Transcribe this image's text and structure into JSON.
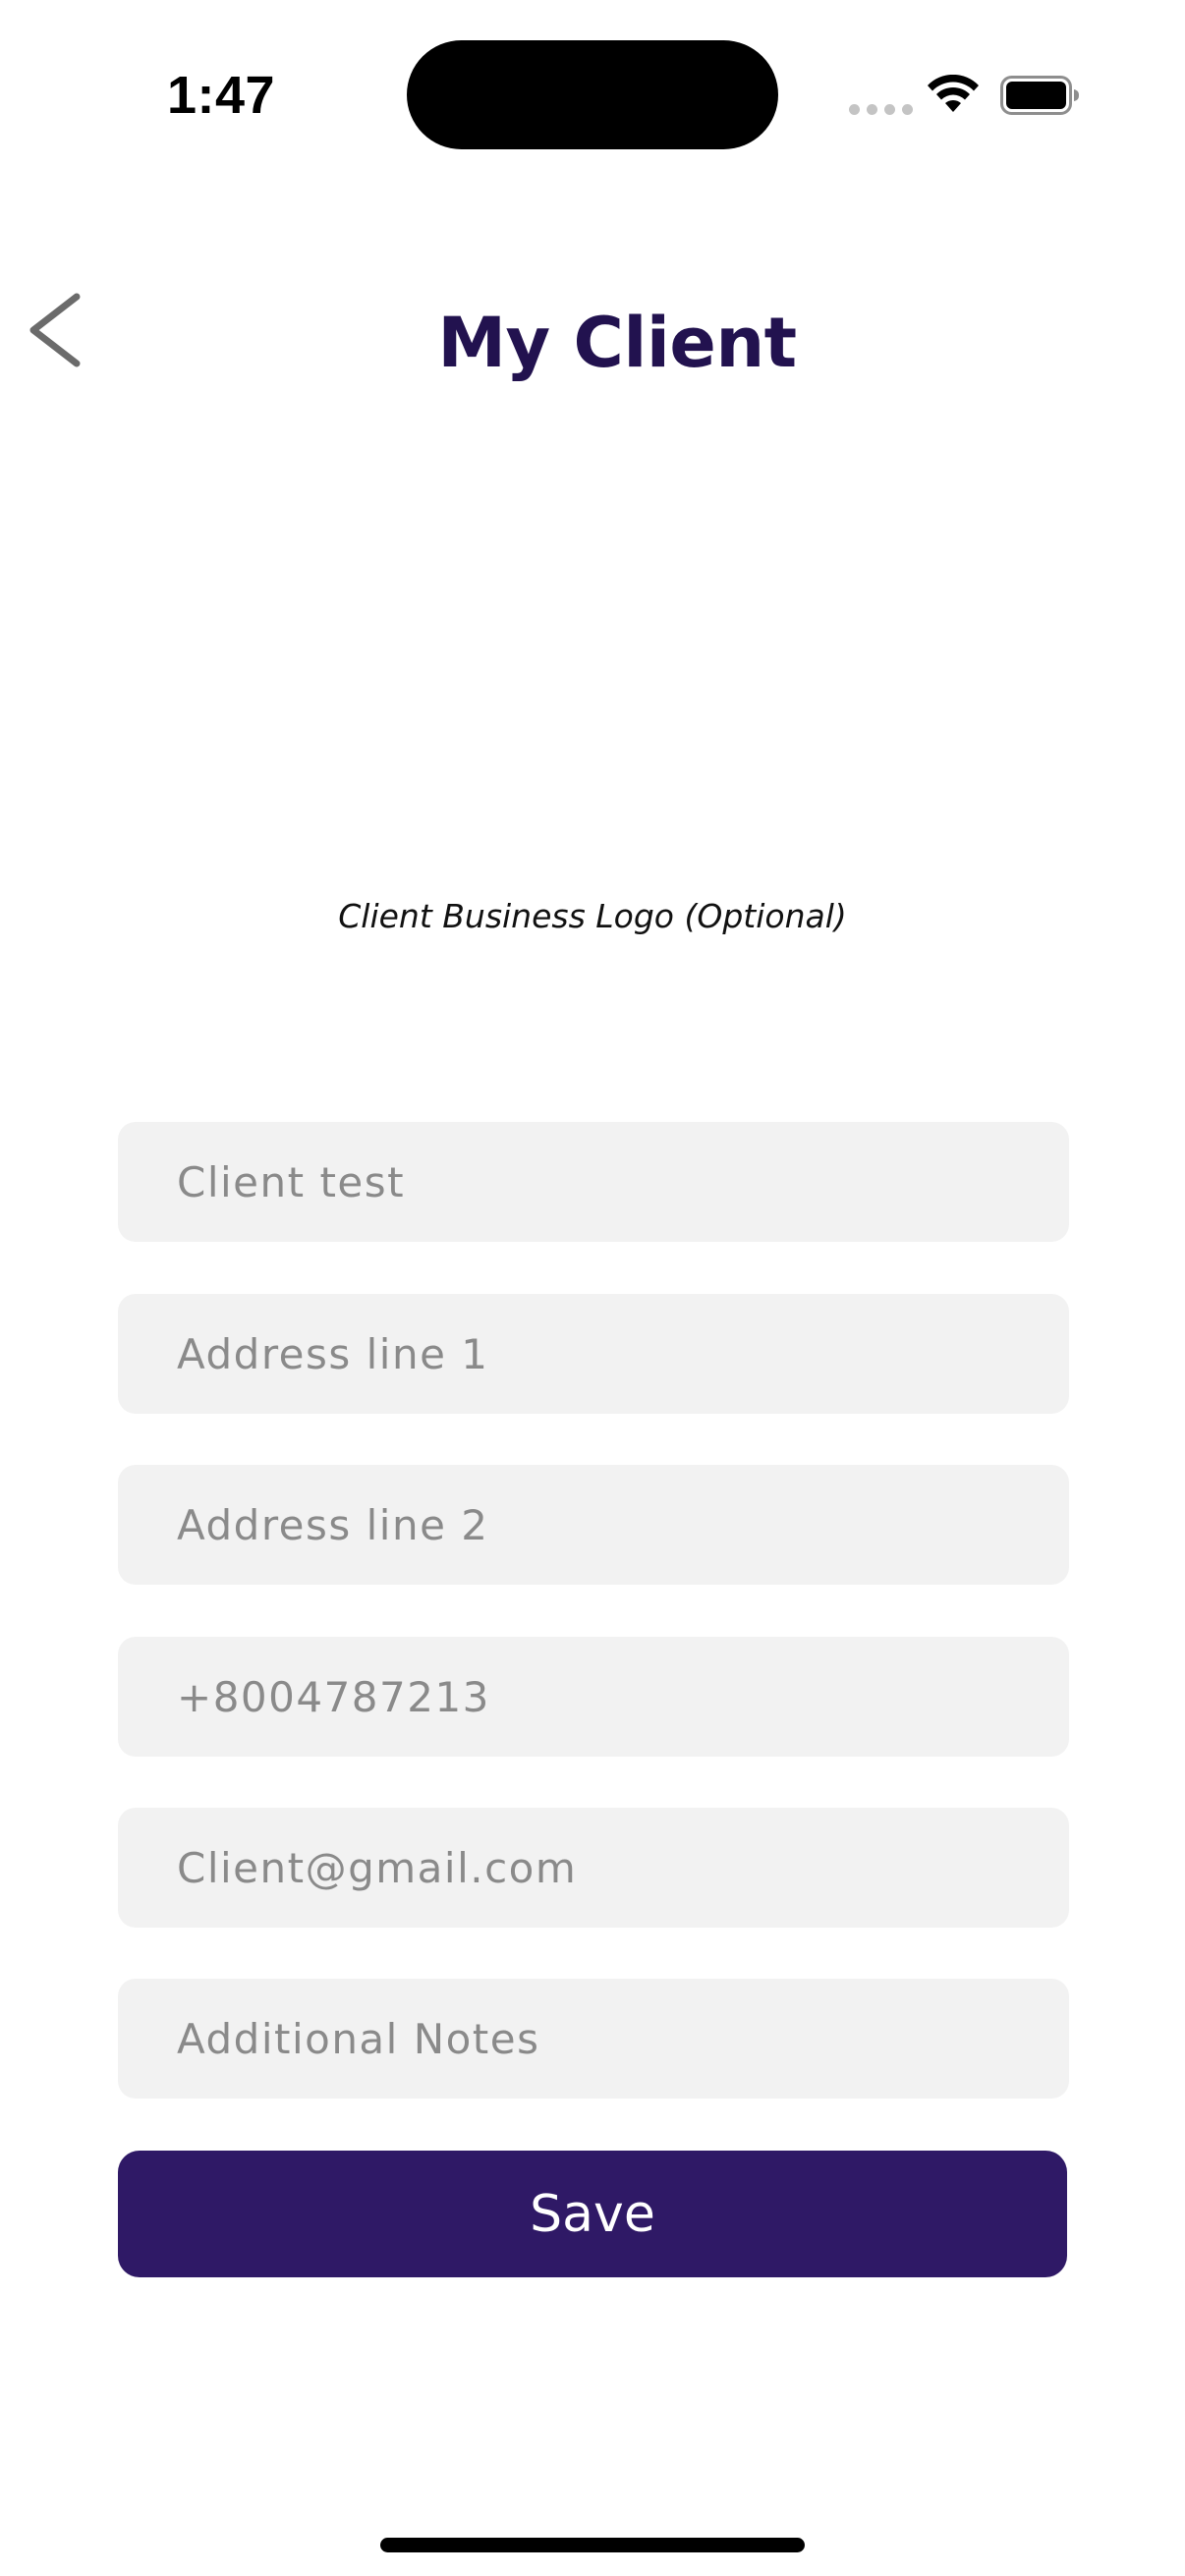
{
  "status_bar": {
    "time": "1:47",
    "wifi_icon": "wifi-icon",
    "battery_icon": "battery-full-icon",
    "signal_icon": "signal-dots-icon"
  },
  "header": {
    "title": "My Client",
    "back_icon": "chevron-left-icon"
  },
  "logo_section": {
    "caption": "Client Business Logo (Optional)"
  },
  "form": {
    "client_name": {
      "placeholder": "Client test",
      "value": ""
    },
    "address_line_1": {
      "placeholder": "Address line 1",
      "value": ""
    },
    "address_line_2": {
      "placeholder": "Address line 2",
      "value": ""
    },
    "phone": {
      "placeholder": "+8004787213",
      "value": ""
    },
    "email": {
      "placeholder": "Client@gmail.com",
      "value": ""
    },
    "notes": {
      "placeholder": "Additional Notes",
      "value": ""
    },
    "save_label": "Save"
  },
  "colors": {
    "title": "#22124f",
    "primary_button": "#2f1966",
    "field_background": "#f2f2f2",
    "placeholder": "#8a8a8a"
  }
}
